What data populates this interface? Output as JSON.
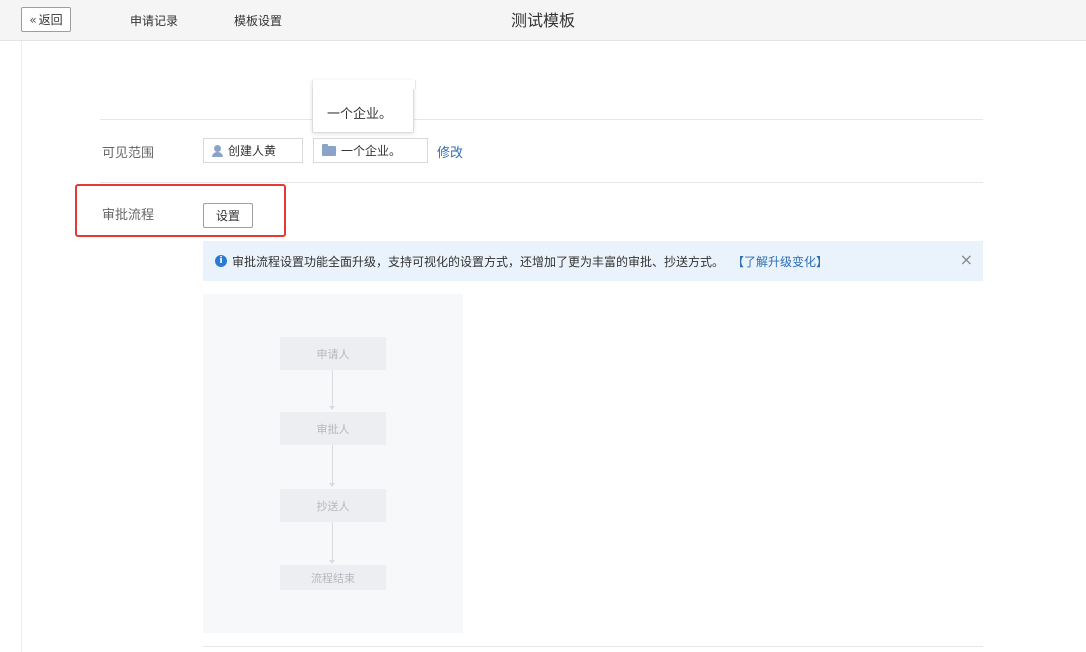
{
  "header": {
    "back_label": "返回",
    "title": "测试模板"
  },
  "tabs": [
    {
      "label": "申请记录"
    },
    {
      "label": "模板设置"
    }
  ],
  "tooltip": {
    "text": "一个企业。"
  },
  "visibility": {
    "label": "可见范围",
    "chips": [
      {
        "text": "创建人黄",
        "icon": "user-icon"
      },
      {
        "text": "一个企业。",
        "icon": "folder-icon"
      }
    ],
    "modify_label": "修改"
  },
  "approval": {
    "label": "审批流程",
    "set_label": "设置"
  },
  "notice": {
    "text": "审批流程设置功能全面升级，支持可视化的设置方式，还增加了更为丰富的审批、抄送方式。",
    "link": "【了解升级变化】",
    "close": "×"
  },
  "flow": {
    "nodes": [
      {
        "label": "申请人"
      },
      {
        "label": "审批人"
      },
      {
        "label": "抄送人"
      },
      {
        "label": "流程结束"
      }
    ]
  },
  "colors": {
    "accent": "#2d6fb5",
    "highlight": "#e53935",
    "notice_bg": "#eaf3fb"
  }
}
